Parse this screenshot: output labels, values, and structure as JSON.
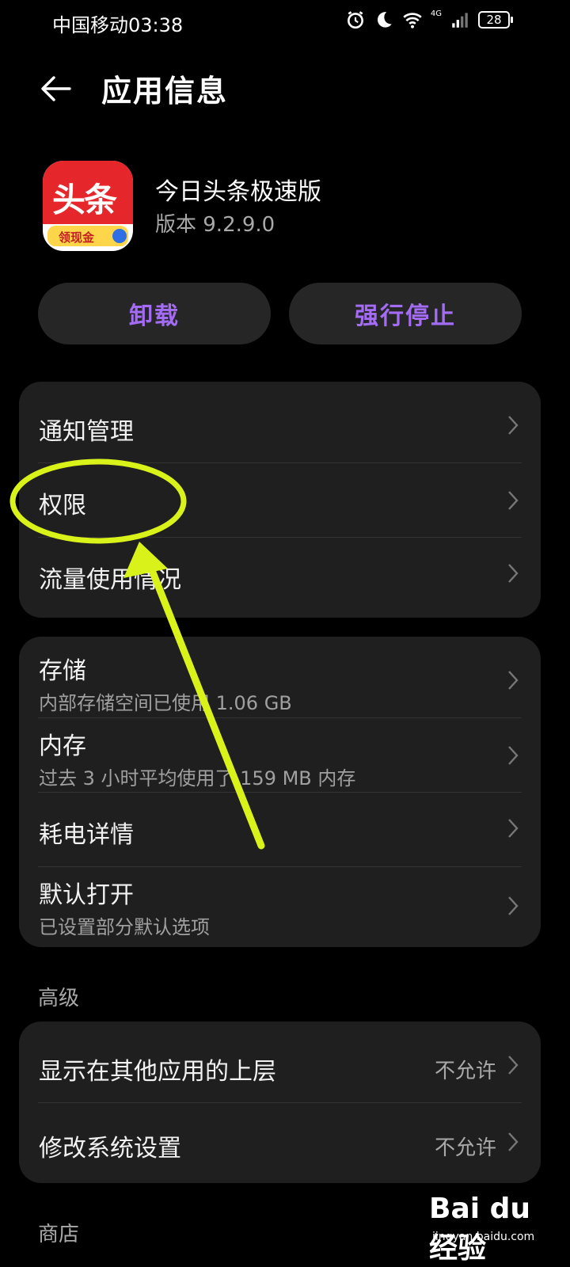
{
  "status_bar": {
    "carrier_time": "中国移动03:38",
    "net_type": "4G",
    "battery": "28",
    "icons": [
      "alarm-icon",
      "moon-icon",
      "wifi-icon",
      "signal-icon",
      "battery-icon"
    ]
  },
  "header": {
    "title": "应用信息",
    "back_icon": "back-arrow-icon"
  },
  "app": {
    "name": "今日头条极速版",
    "version": "版本 9.2.9.0",
    "icon_logo_text": "头条",
    "icon_ribbon_text": "领现金"
  },
  "actions": {
    "uninstall": "卸载",
    "force_stop": "强行停止"
  },
  "group1": {
    "items": [
      {
        "title": "通知管理"
      },
      {
        "title": "权限"
      },
      {
        "title": "流量使用情况"
      }
    ]
  },
  "group2": {
    "items": [
      {
        "title": "存储",
        "sub": "内部存储空间已使用 1.06 GB"
      },
      {
        "title": "内存",
        "sub": "过去 3 小时平均使用了 159 MB 内存"
      },
      {
        "title": "耗电详情"
      },
      {
        "title": "默认打开",
        "sub": "已设置部分默认选项"
      }
    ]
  },
  "advanced": {
    "label": "高级",
    "items": [
      {
        "title": "显示在其他应用的上层",
        "value": "不允许"
      },
      {
        "title": "修改系统设置",
        "value": "不允许"
      }
    ]
  },
  "store": {
    "label": "商店"
  },
  "watermark": {
    "logo": "Bai du 经验",
    "sub": "jingyan.baidu.com"
  },
  "colors": {
    "background": "#000000",
    "card": "#1f1f1f",
    "accent_purple": "#a46cf5",
    "annotation_green": "#d9f21a"
  }
}
